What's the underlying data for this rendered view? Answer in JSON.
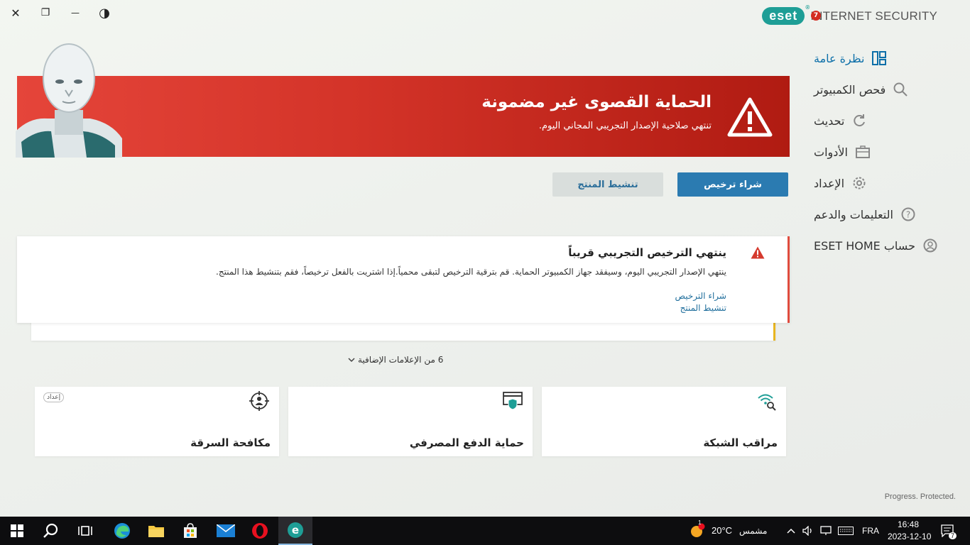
{
  "window": {
    "close_icon": "✕",
    "restore_icon": "❐",
    "minimize_icon": "—",
    "contrast_icon": "◑"
  },
  "brand": {
    "logo": "eset",
    "product": "INTERNET SECURITY"
  },
  "nav": {
    "badge": "7",
    "items": [
      {
        "label": "نظرة عامة"
      },
      {
        "label": "فحص الكمبيوتر"
      },
      {
        "label": "تحديث"
      },
      {
        "label": "الأدوات"
      },
      {
        "label": "الإعداد"
      },
      {
        "label": "التعليمات والدعم"
      },
      {
        "label": "حساب ESET HOME"
      }
    ]
  },
  "banner": {
    "title": "الحماية القصوى غير مضمونة",
    "subtitle": "تنتهي صلاحية الإصدار التجريبي المجاني اليوم."
  },
  "buttons": {
    "buy": "شراء ترخيص",
    "activate": "تنشيط المنتج"
  },
  "notification": {
    "title": "ينتهي الترخيص التجريبي قريباً",
    "text": "ينتهي الإصدار التجريبي اليوم، وسيفقد جهاز الكمبيوتر الحماية. قم بترقية الترخيص لتبقى محمياً.إذا اشتريت بالفعل ترخيصاً، فقم بتنشيط هذا المنتج.",
    "link_buy": "شراء الترخيص",
    "link_activate": "تنشيط المنتج"
  },
  "more_notifications": "6 من الإعلامات الإضافية",
  "cards": [
    {
      "title": "مراقب الشبكة",
      "tag": ""
    },
    {
      "title": "حماية الدفع المصرفي",
      "tag": ""
    },
    {
      "title": "مكافحة السرقة",
      "tag": "إعداد"
    }
  ],
  "tagline": "Progress. Protected.",
  "taskbar": {
    "weather_temp": "20°C",
    "weather_badge": "1",
    "weather_label": "مشمس",
    "lang": "FRA",
    "time": "16:48",
    "date": "2023-12-10",
    "notif_count": "7"
  },
  "colors": {
    "accent": "#2b7bb1",
    "brand": "#1e9e96",
    "alert": "#d33328",
    "warning": "#e8b520"
  }
}
